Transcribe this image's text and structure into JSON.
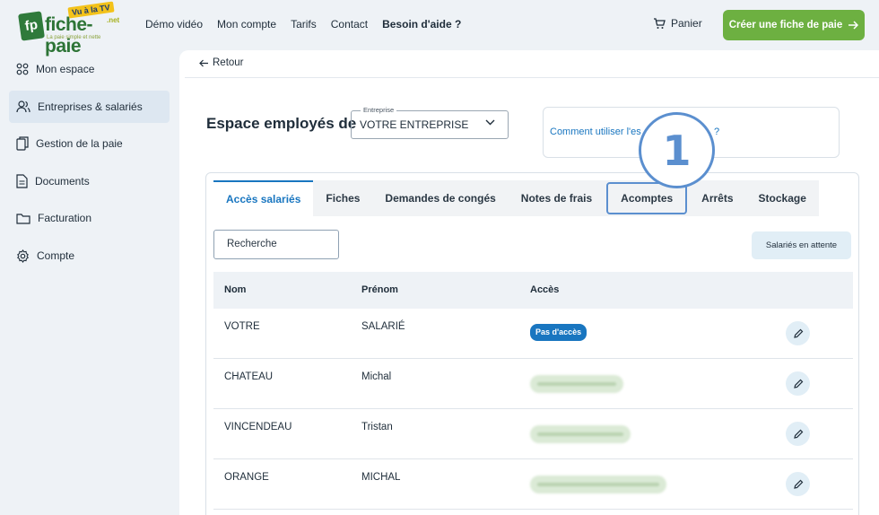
{
  "header": {
    "logo": {
      "brand": "fiche-paie",
      "badge": "Vu à la TV",
      "suffix": ".net",
      "tagline": "La paie simple et nette",
      "mark": "fp"
    },
    "nav": [
      "Démo vidéo",
      "Mon compte",
      "Tarifs",
      "Contact",
      "Besoin d'aide ?"
    ],
    "cart_label": "Panier",
    "cta_label": "Créer une fiche de paie",
    "cta_color": "#6db041"
  },
  "sidebar": {
    "items": [
      {
        "label": "Mon espace",
        "icon": "grid-icon"
      },
      {
        "label": "Entreprises & salariés",
        "icon": "users-icon",
        "active": true
      },
      {
        "label": "Gestion de la paie",
        "icon": "files-icon"
      },
      {
        "label": "Documents",
        "icon": "document-icon"
      },
      {
        "label": "Facturation",
        "icon": "folder-icon"
      },
      {
        "label": "Compte",
        "icon": "gear-icon"
      }
    ]
  },
  "main": {
    "back_label": "Retour",
    "title": "Espace employés de",
    "company_select": {
      "legend": "Entreprise",
      "value": "VOTRE ENTREPRISE"
    },
    "help_text": "Comment utiliser l'es",
    "help_text_end": "?",
    "callout_number": "1",
    "tabs": [
      {
        "label": "Accès salariés",
        "active": true
      },
      {
        "label": "Fiches"
      },
      {
        "label": "Demandes de congés"
      },
      {
        "label": "Notes de frais"
      },
      {
        "label": "Acomptes",
        "highlighted": true
      },
      {
        "label": "Arrêts"
      },
      {
        "label": "Stockage"
      }
    ],
    "search_placeholder": "Recherche",
    "pending_label": "Salariés en attente",
    "table": {
      "headers": [
        "Nom",
        "Prénom",
        "Accès"
      ],
      "rows": [
        {
          "nom": "VOTRE",
          "prenom": "SALARIÉ",
          "acces": "Pas d'accès"
        },
        {
          "nom": "CHATEAU",
          "prenom": "Michal",
          "acces": ""
        },
        {
          "nom": "VINCENDEAU",
          "prenom": "Tristan",
          "acces": ""
        },
        {
          "nom": "ORANGE",
          "prenom": "MICHAL",
          "acces": ""
        }
      ]
    },
    "accent_color": "#1976c0"
  }
}
